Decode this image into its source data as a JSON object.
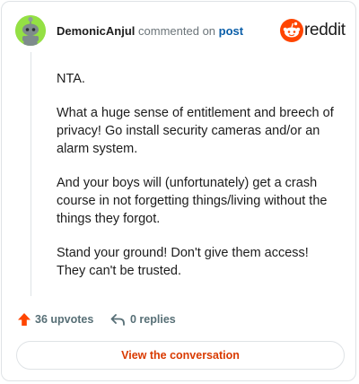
{
  "comment": {
    "username": "DemonicAnjul",
    "action_text": "commented on",
    "post_link": "post",
    "paragraphs": [
      "NTA.",
      "What a huge sense of entitlement and breech of privacy! Go install security cameras and/or an alarm system.",
      "And your boys will (unfortunately) get a crash course in not forgetting things/living without the things they forgot.",
      "Stand your ground! Don't give them access! They can't be trusted."
    ]
  },
  "brand": {
    "name": "reddit",
    "icon": "reddit-snoo-icon",
    "color": "#ff4500"
  },
  "footer": {
    "upvotes_label": "36 upvotes",
    "upvote_icon": "upvote-arrow-icon",
    "upvote_color": "#ff4500",
    "replies_label": "0 replies",
    "reply_icon": "reply-arrow-icon"
  },
  "cta": {
    "label": "View the conversation",
    "color": "#d93a00"
  },
  "avatar": {
    "icon": "snoo-avatar-icon",
    "background": "#94e044"
  }
}
